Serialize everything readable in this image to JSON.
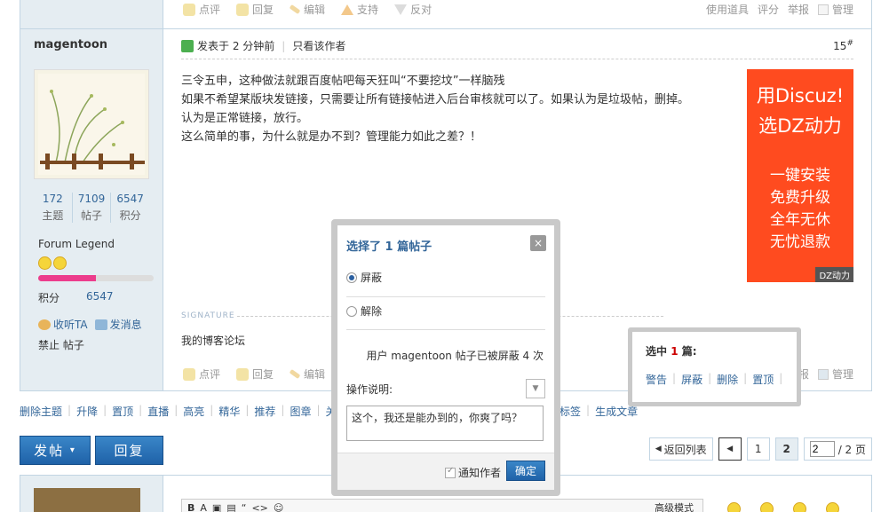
{
  "post_actions": {
    "rate": "点评",
    "reply": "回复",
    "edit": "编辑",
    "support": "支持",
    "oppose": "反对",
    "use_tool": "使用道具",
    "score": "评分",
    "report": "举报",
    "manage": "管理"
  },
  "author": {
    "name": "magentoon",
    "stats": [
      {
        "value": "172",
        "label": "主题"
      },
      {
        "value": "7109",
        "label": "帖子"
      },
      {
        "value": "6547",
        "label": "积分"
      }
    ],
    "rank": "Forum Legend",
    "progress": 0.5,
    "credits_label": "积分",
    "credits_value": "6547",
    "listen": "收听TA",
    "message": "发消息",
    "ban": "禁止 帖子"
  },
  "post": {
    "posted": "发表于 2 分钟前",
    "only_author": "只看该作者",
    "floor": "15",
    "floor_mark": "#",
    "lines": [
      "三令五申，这种做法就跟百度帖吧每天狂叫“不要挖坟”一样脑残",
      "如果不希望某版块发链接，只需要让所有链接帖进入后台审核就可以了。如果认为是垃圾帖，删掉。",
      "认为是正常链接，放行。",
      "这么简单的事，为什么就是办不到？管理能力如此之差？！"
    ],
    "signature_label": "SIGNATURE",
    "signature": "我的博客论坛"
  },
  "ad": {
    "line1": "用Discuz!",
    "line2": "选DZ动力",
    "features": [
      "一键安装",
      "免费升级",
      "全年无休",
      "无忧退款"
    ],
    "brand": "DZ动力"
  },
  "modbar": [
    "删除主题",
    "升降",
    "置顶",
    "直播",
    "高亮",
    "精华",
    "推荐",
    "图章",
    "关闭"
  ],
  "modbar_right": [
    "标签",
    "生成文章"
  ],
  "buttons": {
    "post": "发帖",
    "post_arrow": "▾",
    "reply": "回复"
  },
  "pager": {
    "back": "返回列表",
    "pages": [
      "1",
      "2"
    ],
    "current": "2",
    "total": "/ 2 页"
  },
  "selection": {
    "prefix": "选中",
    "count": "1",
    "suffix": "篇:",
    "links": [
      "警告",
      "屏蔽",
      "删除",
      "置顶"
    ]
  },
  "dialog": {
    "title_prefix": "选择了",
    "title_count": "1",
    "title_suffix": "篇帖子",
    "close": "×",
    "option_block": "屏蔽",
    "option_unblock": "解除",
    "note": "用户 magentoon 帖子已被屏蔽 4 次",
    "reason_label": "操作说明:",
    "reason_value": "这个，我还是能办到的，你爽了吗？",
    "notify": "通知作者",
    "ok": "确定"
  },
  "editor": {
    "tools": [
      "B",
      "A",
      "▣",
      "▤",
      "“",
      "<>",
      "☺"
    ],
    "advanced": "高级模式"
  }
}
